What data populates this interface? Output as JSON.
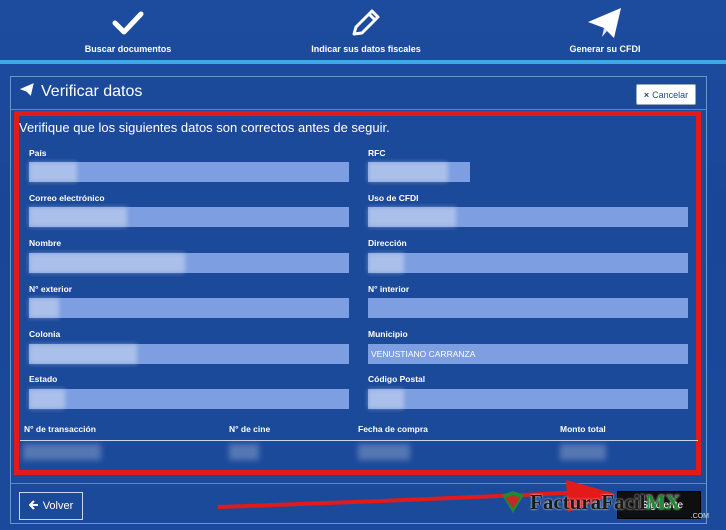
{
  "steps": [
    {
      "label": "Buscar documentos",
      "icon": "check-icon"
    },
    {
      "label": "Indicar sus datos fiscales",
      "icon": "pencil-icon"
    },
    {
      "label": "Generar su CFDI",
      "icon": "paper-plane-icon"
    }
  ],
  "panel": {
    "title": "Verificar datos",
    "cancel_label": "Cancelar",
    "intro": "Verifique que los siguientes datos son correctos antes de seguir."
  },
  "fields": {
    "pais": {
      "label": "País",
      "value": ""
    },
    "rfc": {
      "label": "RFC",
      "value": ""
    },
    "correo": {
      "label": "Correo electrónico",
      "value": ""
    },
    "uso_cfdi": {
      "label": "Uso de CFDI",
      "value": ""
    },
    "nombre": {
      "label": "Nombre",
      "value": ""
    },
    "direccion": {
      "label": "Dirección",
      "value": ""
    },
    "num_exterior": {
      "label": "N° exterior",
      "value": ""
    },
    "num_interior": {
      "label": "N° interior",
      "value": ""
    },
    "colonia": {
      "label": "Colonia",
      "value": ""
    },
    "municipio": {
      "label": "Municipio",
      "value": "VENUSTIANO CARRANZA"
    },
    "estado": {
      "label": "Estado",
      "value": ""
    },
    "codigo_postal": {
      "label": "Código Postal",
      "value": ""
    }
  },
  "table": {
    "headers": [
      "N° de transacción",
      "N° de cine",
      "Fecha de compra",
      "Monto total"
    ]
  },
  "buttons": {
    "back_label": "Volver",
    "next_label": "Siguiente"
  },
  "logo": {
    "text": "FacturaFacil",
    "suffix": "MX",
    "domain": ".COM"
  },
  "colors": {
    "background": "#1b4a9c",
    "accent_bar": "#3fa8e8",
    "highlight": "#e21a1a",
    "input": "#7d9ee0"
  }
}
